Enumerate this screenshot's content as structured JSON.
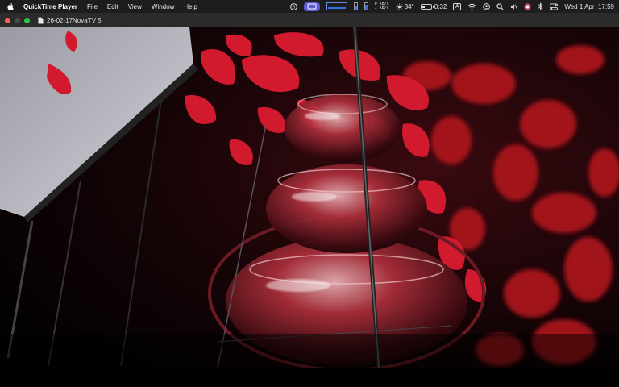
{
  "menubar": {
    "app_name": "QuickTime Player",
    "items": [
      "File",
      "Edit",
      "View",
      "Window",
      "Help"
    ],
    "temperature": "34°",
    "battery_time": "0:32",
    "input_source": "A",
    "net_up": "0 KB/s",
    "net_down": "1 KB/s",
    "clock": "Wed 1 Apr  17:59"
  },
  "window": {
    "title": "26-02-17NovaTV 5"
  },
  "colors": {
    "menubar_bg": "#1d1d1f",
    "titlebar_bg": "#2b2b2b",
    "close": "#ff5f57",
    "zoom": "#28c840",
    "petal": "#c8162a",
    "accent": "#5b5bd6"
  }
}
